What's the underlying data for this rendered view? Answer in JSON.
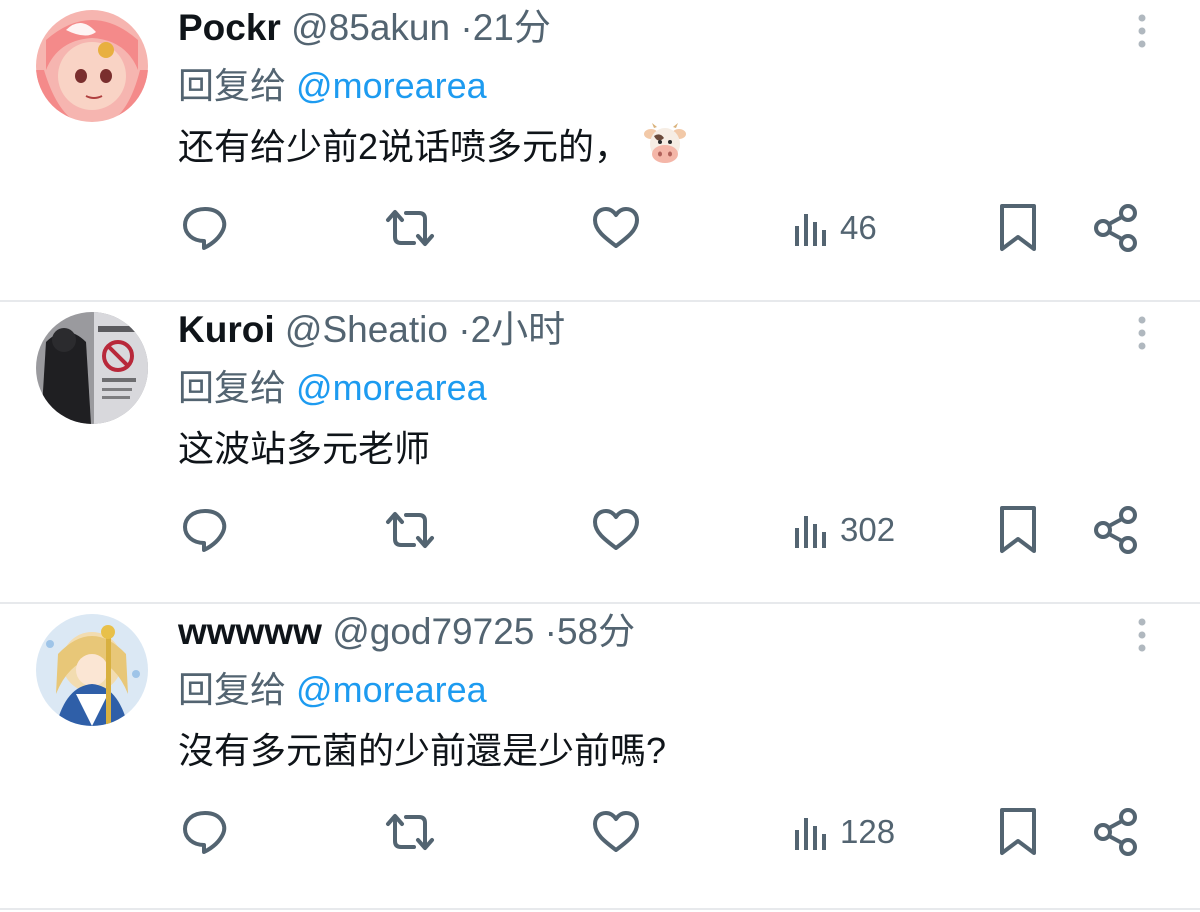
{
  "replies": [
    {
      "name": "Pockr",
      "handle": "@85akun",
      "separator": "·",
      "time": "21分",
      "reply_prefix": "回复给",
      "reply_to": "@morearea",
      "text": "还有给少前2说话喷多元的，",
      "views": "46",
      "emoji": "cow-face-icon",
      "avatar_color": "#f4a6a0"
    },
    {
      "name": "Kuroi",
      "handle": "@Sheatio",
      "separator": "·",
      "time": "2小时",
      "reply_prefix": "回复给",
      "reply_to": "@morearea",
      "text": "这波站多元老师",
      "views": "302",
      "avatar_color": "#3b3b3e"
    },
    {
      "name": "wwwww",
      "handle": "@god79725",
      "separator": "·",
      "time": "58分",
      "reply_prefix": "回复给",
      "reply_to": "@morearea",
      "text": "沒有多元菌的少前還是少前嗎?",
      "views": "128",
      "avatar_color": "#cfe0f2"
    }
  ],
  "colors": {
    "text": "#0f1419",
    "secondary": "#536471",
    "link": "#1d9bf0",
    "divider": "#e7e9ec"
  }
}
